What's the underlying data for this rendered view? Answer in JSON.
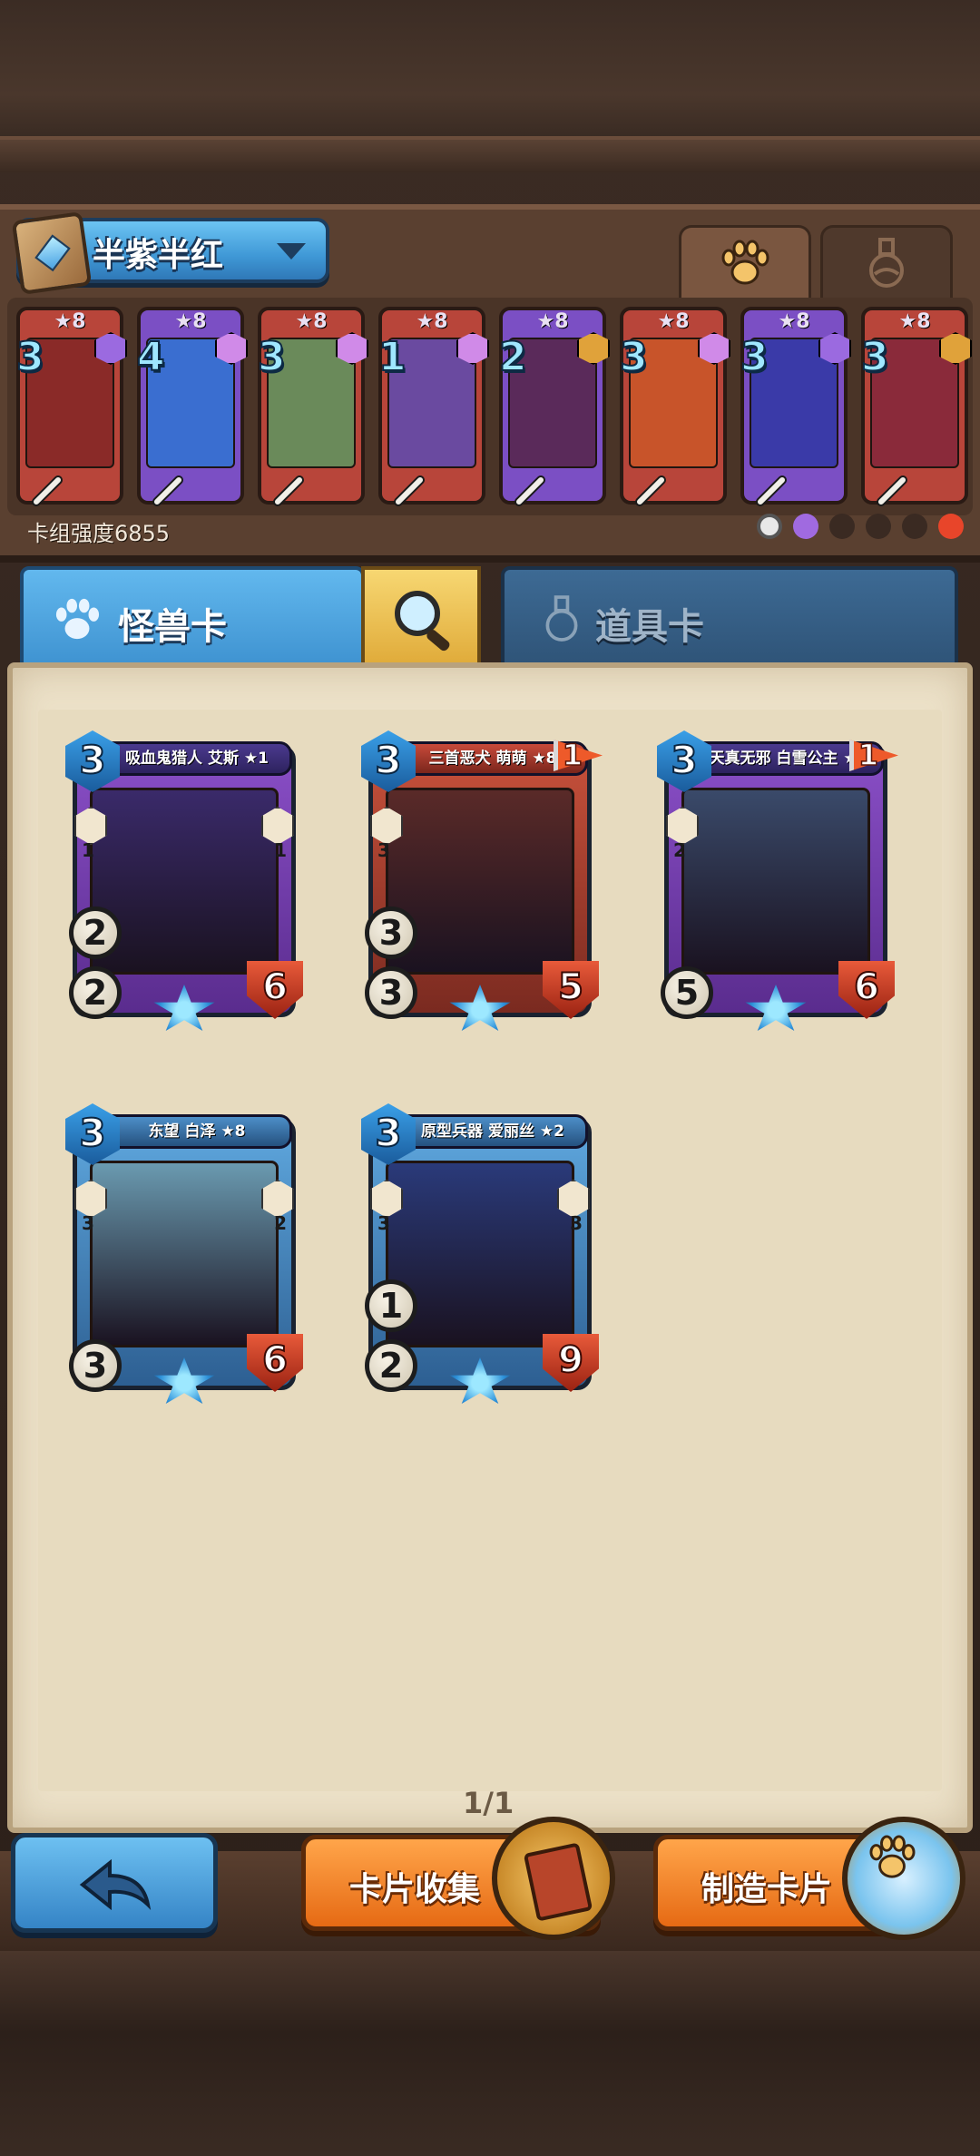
{
  "deck": {
    "name": "半紫半红",
    "strength_label": "卡组强度6855"
  },
  "top_tabs": {
    "monster_icon": "paw-icon",
    "item_icon": "potion-icon"
  },
  "mini_cards": [
    {
      "star": "★8",
      "cost": "3",
      "frame_color": "#b8453a",
      "art_color": "#8a2a28",
      "gem_color": "#9b6ae0"
    },
    {
      "star": "★8",
      "cost": "4",
      "frame_color": "#7b4fc4",
      "art_color": "#3a6ed0",
      "gem_color": "#d08ae8"
    },
    {
      "star": "★8",
      "cost": "3",
      "frame_color": "#b8453a",
      "art_color": "#6a8a5a",
      "gem_color": "#d08ae8"
    },
    {
      "star": "★8",
      "cost": "1",
      "frame_color": "#b8453a",
      "art_color": "#6a4aa0",
      "gem_color": "#d08ae8"
    },
    {
      "star": "★8",
      "cost": "2",
      "frame_color": "#7b4fc4",
      "art_color": "#5a2a5a",
      "gem_color": "#e0a23a"
    },
    {
      "star": "★8",
      "cost": "3",
      "frame_color": "#b8453a",
      "art_color": "#c8542a",
      "gem_color": "#d08ae8"
    },
    {
      "star": "★8",
      "cost": "3",
      "frame_color": "#7b4fc4",
      "art_color": "#3a3aa8",
      "gem_color": "#9b6ae0"
    },
    {
      "star": "★8",
      "cost": "3",
      "frame_color": "#b8453a",
      "art_color": "#8a2a3a",
      "gem_color": "#e0a23a"
    }
  ],
  "card_type_tabs": {
    "monster_label": "怪兽卡",
    "item_label": "道具卡"
  },
  "cards": [
    {
      "name": "吸血鬼猎人 艾斯 ★1",
      "cost": "3",
      "attack": "2",
      "defense": "2",
      "hp": "6",
      "frame": "purple",
      "flag": "",
      "left_hex": "1",
      "right_hex": "1",
      "art_color": "#3a2a6a"
    },
    {
      "name": "三首恶犬 萌萌 ★8",
      "cost": "3",
      "attack": "3",
      "defense": "3",
      "hp": "5",
      "frame": "red",
      "flag": "1",
      "left_hex": "3",
      "right_hex": "",
      "art_color": "#5a2a28"
    },
    {
      "name": "天真无邪 白雪公主 ★8",
      "cost": "3",
      "attack": "",
      "defense": "5",
      "hp": "6",
      "frame": "purple",
      "flag": "1",
      "left_hex": "2",
      "right_hex": "",
      "art_color": "#3a4a6a"
    },
    {
      "name": "东望 白泽 ★8",
      "cost": "3",
      "attack": "",
      "defense": "3",
      "hp": "6",
      "frame": "blue",
      "flag": "",
      "left_hex": "3",
      "right_hex": "2",
      "art_color": "#6a9ab0"
    },
    {
      "name": "原型兵器 爱丽丝 ★2",
      "cost": "3",
      "attack": "1",
      "defense": "2",
      "hp": "9",
      "frame": "blue",
      "flag": "",
      "left_hex": "3",
      "right_hex": "3",
      "art_color": "#2a3a7a"
    }
  ],
  "card_subhexes": {
    "card2": [
      "1",
      ""
    ],
    "card3": [
      "2",
      "1",
      "1"
    ]
  },
  "page": "1/1",
  "buttons": {
    "back_icon": "back-arrow-icon",
    "collection_label": "卡片收集",
    "craft_label": "制造卡片"
  }
}
